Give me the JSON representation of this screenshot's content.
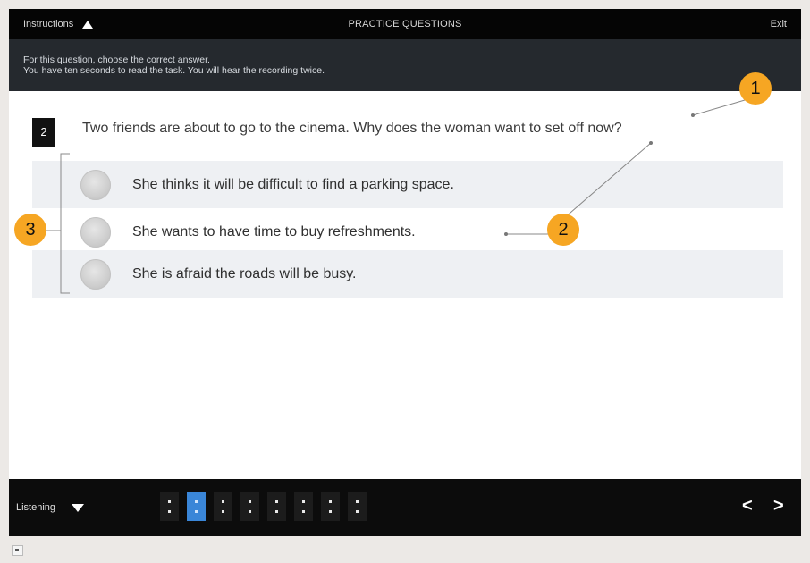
{
  "topbar": {
    "instructions_label": "Instructions",
    "title": "PRACTICE QUESTIONS",
    "exit_label": "Exit"
  },
  "instructions": {
    "line1": "For this question, choose the correct answer.",
    "line2": "You have ten seconds to read the task. You will hear the recording twice."
  },
  "question": {
    "number": "2",
    "text": "Two friends are about to go to the cinema. Why does the woman want to set off now?",
    "options": [
      "She thinks it will be difficult to find a parking space.",
      "She wants to have time to buy refreshments.",
      "She is afraid the roads will be busy."
    ]
  },
  "callouts": [
    "1",
    "2",
    "3"
  ],
  "bottombar": {
    "section_label": "Listening",
    "pages_count": 8,
    "active_page_index": 1,
    "prev_icon": "<",
    "next_icon": ">"
  },
  "colors": {
    "callout": "#f6a623",
    "active_page": "#3a86d8"
  }
}
